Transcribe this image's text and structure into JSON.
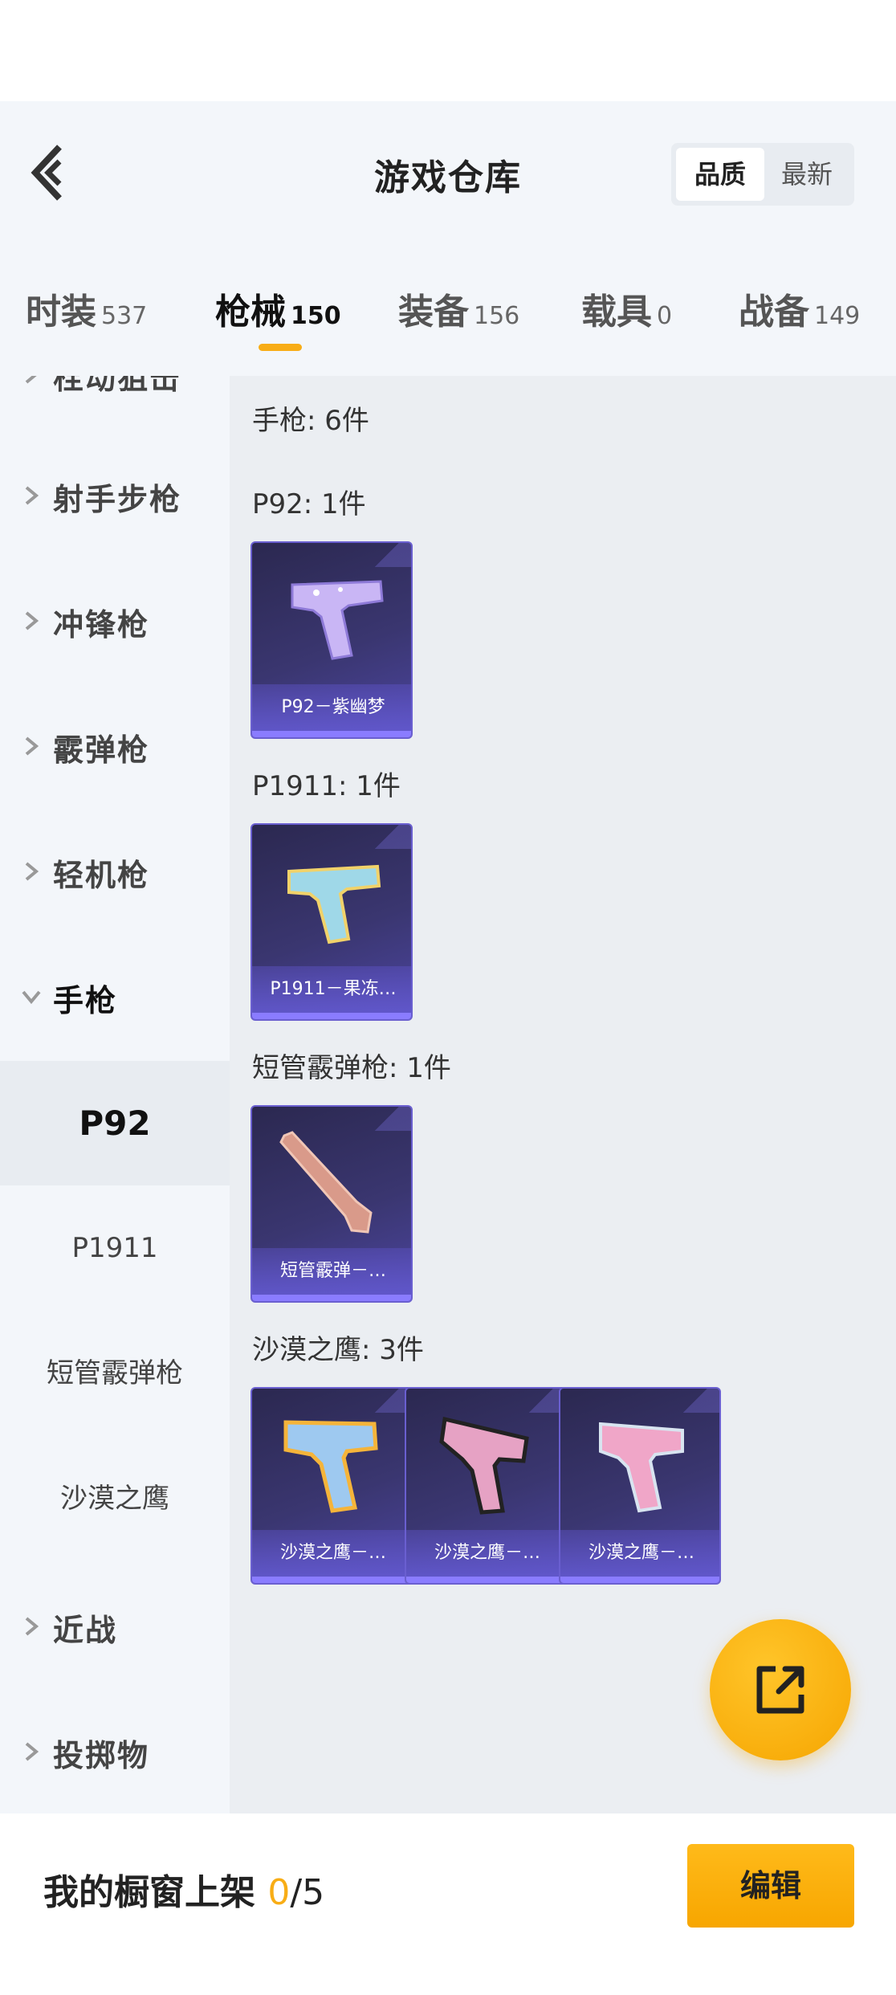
{
  "header": {
    "title": "游戏仓库",
    "sort": {
      "active": "品质",
      "other": "最新"
    }
  },
  "tabs": [
    {
      "label": "时装",
      "count": "537"
    },
    {
      "label": "枪械",
      "count": "150"
    },
    {
      "label": "装备",
      "count": "156"
    },
    {
      "label": "载具",
      "count": "0"
    },
    {
      "label": "战备",
      "count": "149"
    }
  ],
  "active_tab": "枪械",
  "sidebar": {
    "partial_top": "栓动狙击",
    "categories": [
      "射手步枪",
      "冲锋枪",
      "霰弹枪",
      "轻机枪",
      "手枪"
    ],
    "subitems": [
      "P92",
      "P1911",
      "短管霰弹枪",
      "沙漠之鹰"
    ],
    "selected_sub": "P92",
    "categories_after": [
      "近战",
      "投掷物"
    ]
  },
  "main": {
    "section_title": "手枪: 6件",
    "groups": [
      {
        "title": "P92: 1件",
        "items": [
          "P92－紫幽梦"
        ]
      },
      {
        "title": "P1911: 1件",
        "items": [
          "P1911－果冻…"
        ]
      },
      {
        "title": "短管霰弹枪: 1件",
        "items": [
          "短管霰弹－…"
        ]
      },
      {
        "title": "沙漠之鹰: 3件",
        "items": [
          "沙漠之鹰－…",
          "沙漠之鹰－…",
          "沙漠之鹰－…"
        ]
      }
    ]
  },
  "bottom": {
    "label": "我的橱窗上架",
    "current": "0",
    "max": "/5",
    "edit_label": "编辑"
  },
  "colors": {
    "accent": "#f8ad16",
    "card": "#3a3670"
  }
}
